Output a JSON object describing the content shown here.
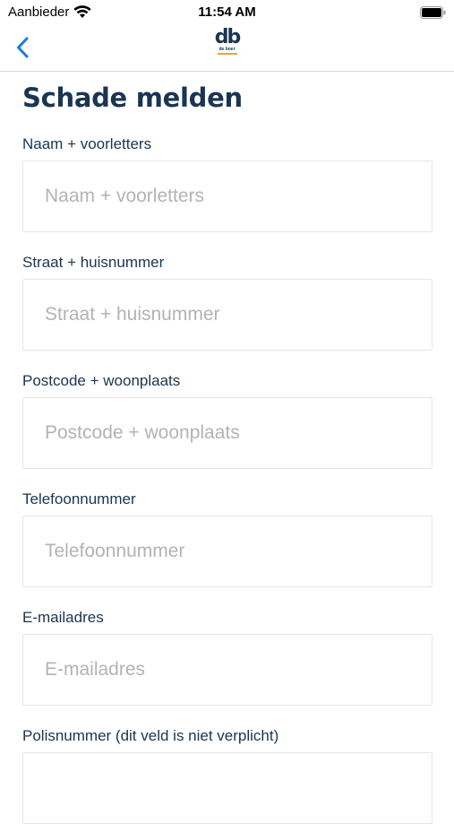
{
  "status": {
    "carrier": "Aanbieder",
    "time": "11:54 AM"
  },
  "nav": {
    "logo_mark": "db",
    "logo_sub": "de boer"
  },
  "page": {
    "title": "Schade melden"
  },
  "form": {
    "fields": [
      {
        "label": "Naam + voorletters",
        "placeholder": "Naam + voorletters"
      },
      {
        "label": "Straat + huisnummer",
        "placeholder": "Straat + huisnummer"
      },
      {
        "label": "Postcode + woonplaats",
        "placeholder": "Postcode + woonplaats"
      },
      {
        "label": "Telefoonnummer",
        "placeholder": "Telefoonnummer"
      },
      {
        "label": "E-mailadres",
        "placeholder": "E-mailadres"
      },
      {
        "label": "Polisnummer (dit veld is niet verplicht)",
        "placeholder": ""
      }
    ]
  },
  "colors": {
    "text_primary": "#1a3552",
    "accent": "#1a7ae0",
    "logo_accent": "#f0a030",
    "placeholder": "#b3b3b3",
    "input_border": "#e6e6e6"
  },
  "icons": {
    "back": "chevron-left-icon",
    "wifi": "wifi-icon",
    "battery": "battery-icon"
  }
}
